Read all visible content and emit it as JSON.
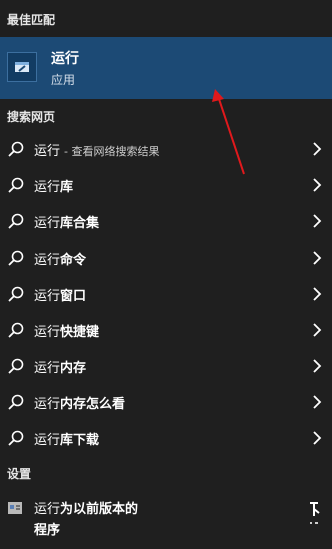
{
  "sections": {
    "best_match": "最佳匹配",
    "web_search": "搜索网页",
    "settings": "设置"
  },
  "best_match": {
    "title": "运行",
    "subtitle": "应用"
  },
  "web_results": [
    {
      "prefix": "运行",
      "bold": "",
      "suffix": "- 查看网络搜索结果"
    },
    {
      "prefix": "运行",
      "bold": "库",
      "suffix": ""
    },
    {
      "prefix": "运行",
      "bold": "库合集",
      "suffix": ""
    },
    {
      "prefix": "运行",
      "bold": "命令",
      "suffix": ""
    },
    {
      "prefix": "运行",
      "bold": "窗口",
      "suffix": ""
    },
    {
      "prefix": "运行",
      "bold": "快捷键",
      "suffix": ""
    },
    {
      "prefix": "运行",
      "bold": "内存",
      "suffix": ""
    },
    {
      "prefix": "运行",
      "bold": "内存怎么看",
      "suffix": ""
    },
    {
      "prefix": "运行",
      "bold": "库下载",
      "suffix": ""
    }
  ],
  "settings_item": {
    "prefix": "运行",
    "line1_bold": "为以前版本的",
    "line2_bold": "程序"
  },
  "colors": {
    "background": "#1f1f1f",
    "selected": "#1c4a75",
    "arrow": "#e0191c"
  },
  "icons": {
    "app": "run-app-icon",
    "search": "search-icon",
    "chevron": "chevron-right-icon",
    "settings": "compatibility-settings-icon"
  }
}
